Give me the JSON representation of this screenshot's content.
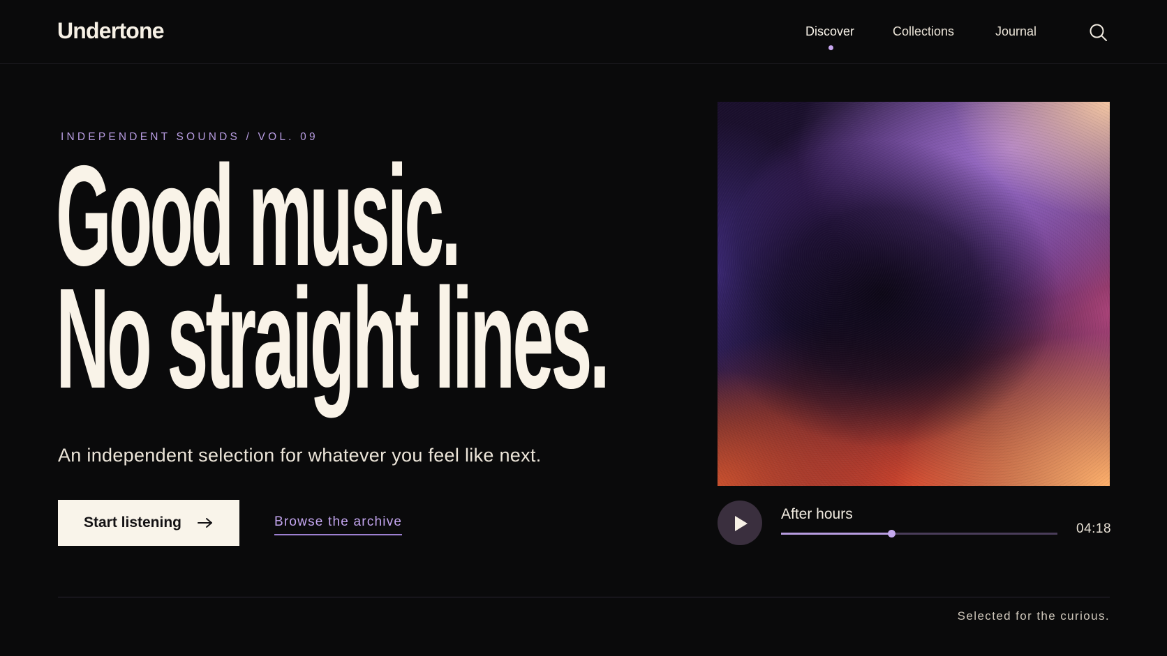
{
  "brand": {
    "name": "Undertone"
  },
  "nav": {
    "items": [
      {
        "label": "Discover",
        "active": true
      },
      {
        "label": "Collections",
        "active": false
      },
      {
        "label": "Journal",
        "active": false
      }
    ],
    "search_icon": "search-icon"
  },
  "hero": {
    "eyebrow": "INDEPENDENT SOUNDS / VOL. 09",
    "headline_line1": "Good music.",
    "headline_line2": "No straight lines.",
    "subtitle": "An independent selection for whatever you feel like next.",
    "primary_cta": "Start listening",
    "primary_cta_icon": "arrow-right-icon",
    "secondary_link": "Browse the archive"
  },
  "player": {
    "play_icon": "play-icon",
    "track_title": "After hours",
    "duration": "04:18",
    "progress": 0.4
  },
  "footer": {
    "tagline": "Selected for the curious."
  },
  "colors": {
    "background": "#0a0a0b",
    "text": "#f7f1e6",
    "accent": "#b79ce0",
    "cta_background": "#f9f4ea"
  }
}
